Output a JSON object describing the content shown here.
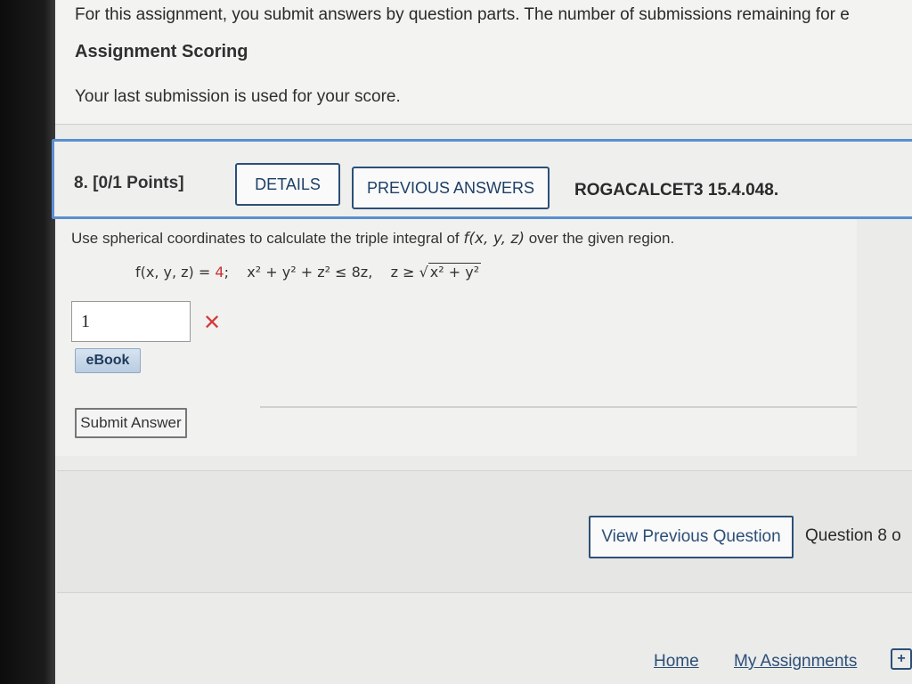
{
  "info": {
    "line": "For this assignment, you submit answers by question parts. The number of submissions remaining for e",
    "scoring_title": "Assignment Scoring",
    "scoring_text": "Your last submission is used for your score."
  },
  "question": {
    "number": "8. [0/1 Points]",
    "details_label": "DETAILS",
    "prev_answers_label": "PREVIOUS ANSWERS",
    "code": "ROGACALCET3 15.4.048.",
    "prompt_start": "Use spherical coordinates to calculate the triple integral of",
    "prompt_func": "f(x, y, z)",
    "prompt_end": "over the given region.",
    "formula_func": "f(x, y, z) = ",
    "formula_value": "4",
    "formula_sep": ";",
    "formula_region": "x² + y² + z² ≤ 8z,",
    "formula_cond": "z ≥ √",
    "formula_sqrt": "x² + y²",
    "answer_value": "1",
    "ebook_label": "eBook",
    "submit_label": "Submit Answer"
  },
  "nav": {
    "view_prev_label": "View Previous Question",
    "counter": "Question 8 o"
  },
  "footer": {
    "home": "Home",
    "my_assignments": "My Assignments"
  },
  "colors": {
    "accent": "#2c4f78",
    "question_border": "#5a8fd0",
    "wrong": "#d33b3b"
  }
}
